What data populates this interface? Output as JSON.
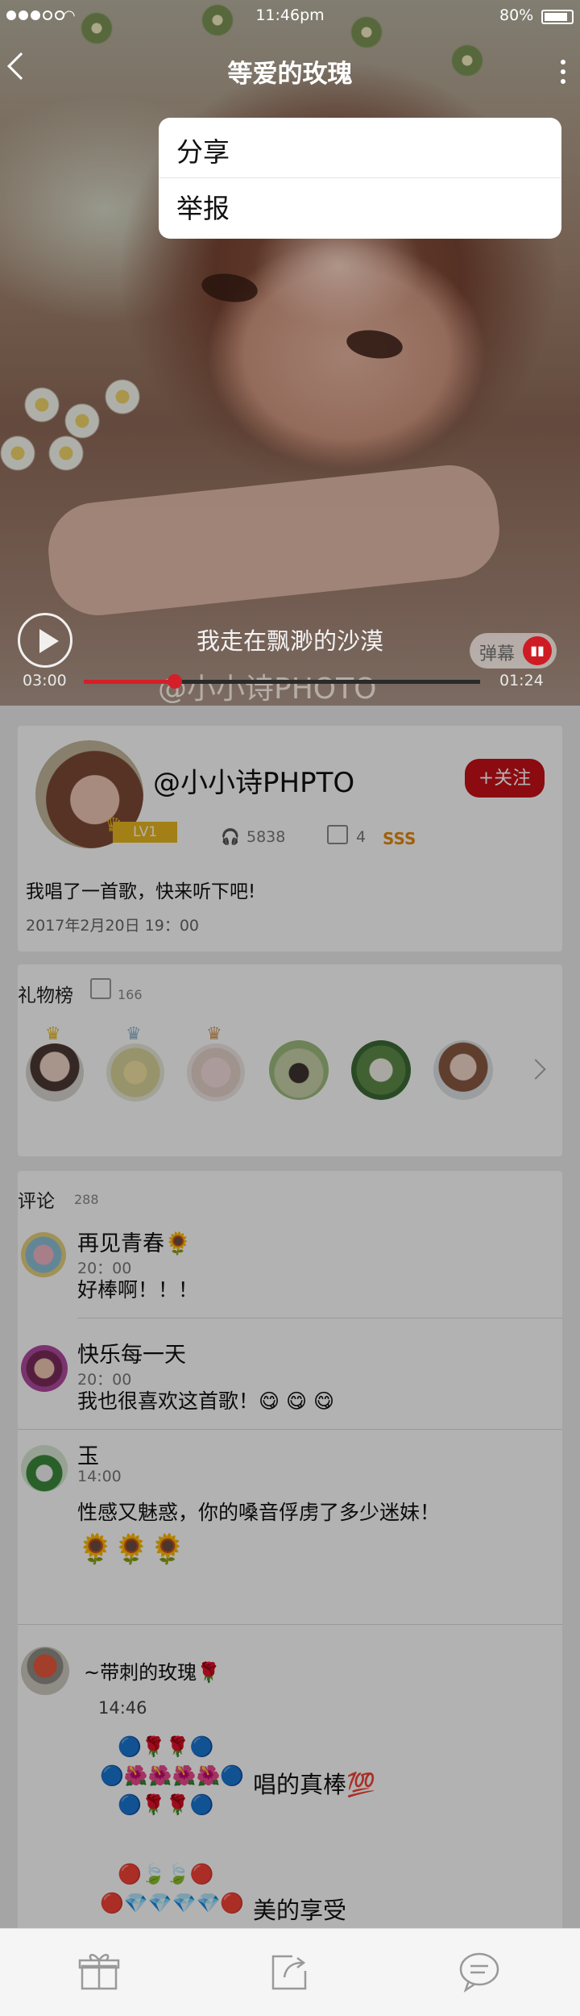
{
  "status_bar": {
    "time": "11:46pm",
    "battery": "80%"
  },
  "header": {
    "title": "等爱的玫瑰"
  },
  "menu": {
    "items": [
      "分享",
      "举报"
    ]
  },
  "player": {
    "lyric": "我走在飘渺的沙漠",
    "watermark": "@小小诗PHOTO",
    "time_elapsed": "03:00",
    "time_total": "01:24",
    "progress": 0.23,
    "danmu_label": "弹幕"
  },
  "post": {
    "username": "@小小诗PHPTO",
    "level": "LV1",
    "follow_label": "+关注",
    "plays": "5838",
    "shares": "4",
    "rank": "SSS",
    "text": "我唱了一首歌，快来听下吧!",
    "date": "2017年2月20日 19：00"
  },
  "gifts": {
    "title": "礼物榜",
    "count": "166"
  },
  "comments": {
    "title": "评论",
    "count": "288",
    "items": [
      {
        "name": "再见青春🌻",
        "time": "20：00",
        "text": "好棒啊！！！"
      },
      {
        "name": "快乐每一天",
        "time": "20：00",
        "text": "我也很喜欢这首歌！😋 😋 😋"
      },
      {
        "name": "玉",
        "time": "14:00",
        "text": "性感又魅惑，你的嗓音俘虏了多少迷妹！",
        "emoji": "🌻🌻🌻"
      },
      {
        "name": "~带刺的玫瑰🌹",
        "time": "14:46",
        "art1": "唱的真棒💯",
        "art2": "美的享受"
      }
    ]
  },
  "colors": {
    "accent": "#c81018",
    "level": "#e9b820",
    "rank": "#e58a10"
  }
}
